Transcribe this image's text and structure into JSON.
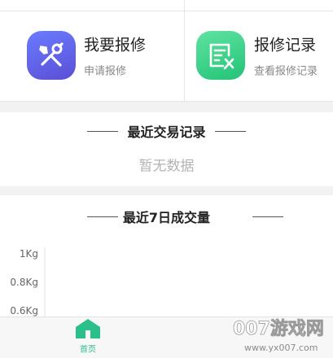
{
  "services": {
    "repair": {
      "title": "我要报修",
      "subtitle": "申请报修",
      "icon": "wrench-screwdriver-icon"
    },
    "records": {
      "title": "报修记录",
      "subtitle": "查看报修记录",
      "icon": "document-wrench-icon"
    }
  },
  "recent_trades": {
    "title": "最近交易记录",
    "empty_text": "暂无数据"
  },
  "weekly_volume": {
    "title": "最近7日成交量"
  },
  "chart_data": {
    "type": "line",
    "title": "最近7日成交量",
    "ylabel": "",
    "xlabel": "",
    "y_ticks": [
      "1Kg",
      "0.8Kg",
      "0.6Kg"
    ],
    "series": []
  },
  "tabbar": {
    "home_label": "首页",
    "home_icon": "home-icon"
  },
  "watermark": {
    "text": "007游戏网",
    "url_text": "www.yx007.com"
  },
  "colors": {
    "accent_green": "#2bbf8a",
    "repair_icon_bg": "#5f64ea",
    "records_icon_bg": "#33cf86"
  }
}
